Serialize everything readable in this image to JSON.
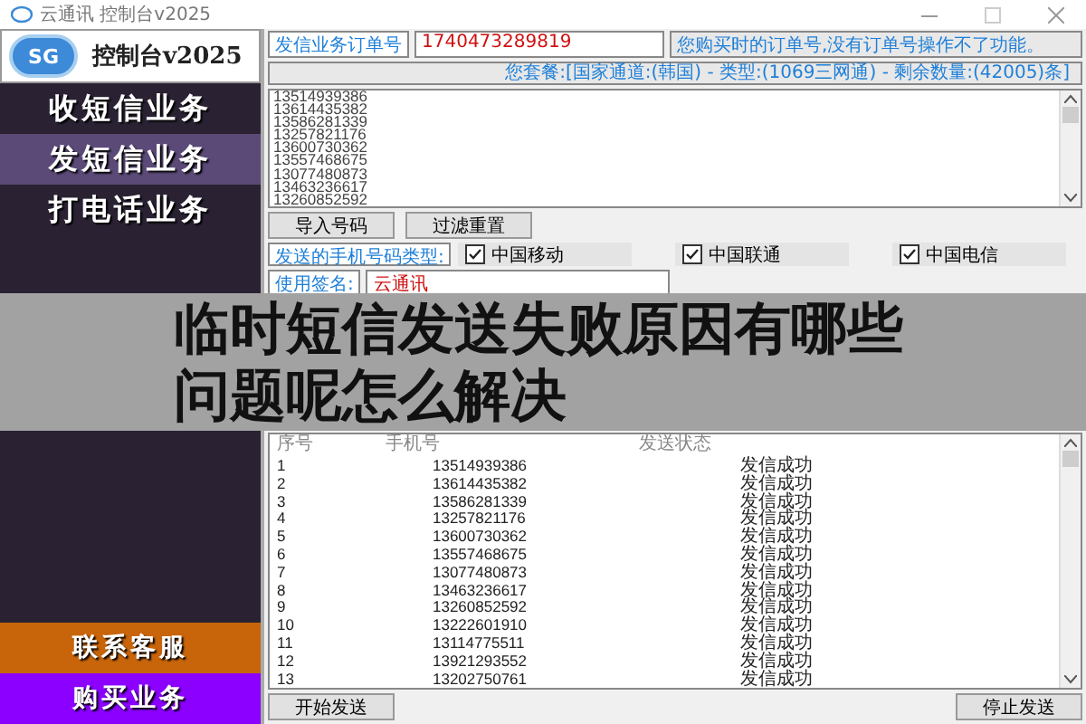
{
  "window": {
    "title": "云通讯 控制台v2025"
  },
  "sidebar": {
    "logo_badge": "SG",
    "logo_text": "控制台v2025",
    "items": [
      {
        "label": "收短信业务",
        "selected": false
      },
      {
        "label": "发短信业务",
        "selected": true
      },
      {
        "label": "打电话业务",
        "selected": false
      }
    ],
    "footer_buttons": [
      {
        "label": "联系客服",
        "color": "#c8650a"
      },
      {
        "label": "购买业务",
        "color": "#8b00ff"
      }
    ]
  },
  "order": {
    "label": "发信业务订单号",
    "value": "1740473289819",
    "hint": "您购买时的订单号,没有订单号操作不了功能。"
  },
  "package_info": "您套餐:[国家通道:(韩国) - 类型:(1069三网通) - 剩余数量:(42005)条]",
  "numbers_input": {
    "lines": [
      "13514939386",
      "13614435382",
      "13586281339",
      "13257821176",
      "13600730362",
      "13557468675",
      "13077480873",
      "13463236617",
      "13260852592"
    ]
  },
  "buttons": [
    "导入号码",
    "过滤重置"
  ],
  "carrier_type": {
    "label": "发送的手机号码类型:",
    "options": [
      {
        "label": "中国移动",
        "checked": true
      },
      {
        "label": "中国联通",
        "checked": true
      },
      {
        "label": "中国电信",
        "checked": true
      }
    ]
  },
  "signature": {
    "label": "使用签名:",
    "value": "云通讯"
  },
  "overlay_title": "临时短信发送失败原因有哪些问题呢怎么解决",
  "table": {
    "columns": [
      "序号",
      "手机号",
      "发送状态"
    ],
    "rows": [
      [
        "1",
        "13514939386",
        "发信成功"
      ],
      [
        "2",
        "13614435382",
        "发信成功"
      ],
      [
        "3",
        "13586281339",
        "发信成功"
      ],
      [
        "4",
        "13257821176",
        "发信成功"
      ],
      [
        "5",
        "13600730362",
        "发信成功"
      ],
      [
        "6",
        "13557468675",
        "发信成功"
      ],
      [
        "7",
        "13077480873",
        "发信成功"
      ],
      [
        "8",
        "13463236617",
        "发信成功"
      ],
      [
        "9",
        "13260852592",
        "发信成功"
      ],
      [
        "10",
        "13222601910",
        "发信成功"
      ],
      [
        "11",
        "13114775511",
        "发信成功"
      ],
      [
        "12",
        "13921293552",
        "发信成功"
      ],
      [
        "13",
        "13202750761",
        "发信成功"
      ]
    ]
  },
  "actions": [
    "开始发送",
    "停止发送"
  ]
}
